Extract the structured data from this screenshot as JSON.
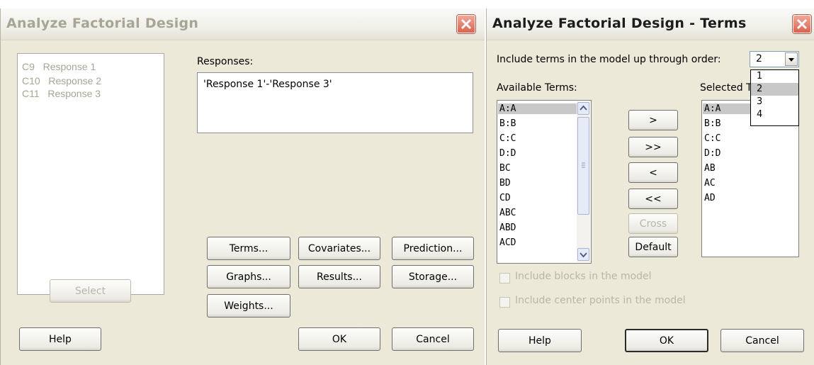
{
  "dialog1": {
    "title": "Analyze Factorial Design",
    "columns": [
      {
        "id": "C9",
        "name": "Response 1"
      },
      {
        "id": "C10",
        "name": "Response 2"
      },
      {
        "id": "C11",
        "name": "Response 3"
      }
    ],
    "select_label": "Select",
    "responses_label": "Responses:",
    "responses_value": "'Response 1'-'Response 3'",
    "buttons": {
      "terms": "Terms...",
      "covariates": "Covariates...",
      "prediction": "Prediction...",
      "graphs": "Graphs...",
      "results": "Results...",
      "storage": "Storage...",
      "weights": "Weights...",
      "help": "Help",
      "ok": "OK",
      "cancel": "Cancel"
    }
  },
  "dialog2": {
    "title": "Analyze Factorial Design - Terms",
    "order_label": "Include terms in the model up through order:",
    "order_value": "2",
    "order_options": [
      "1",
      "2",
      "3",
      "4"
    ],
    "available_label": "Available Terms:",
    "selected_label": "Selected T",
    "available_terms": [
      "A:A",
      "B:B",
      "C:C",
      "D:D",
      "BC",
      "BD",
      "CD",
      "ABC",
      "ABD",
      "ACD"
    ],
    "selected_terms": [
      "A:A",
      "B:B",
      "C:C",
      "D:D",
      "AB",
      "AC",
      "AD"
    ],
    "buttons": {
      "add": ">",
      "add_all": ">>",
      "remove": "<",
      "remove_all": "<<",
      "cross": "Cross",
      "default": "Default",
      "help": "Help",
      "ok": "OK",
      "cancel": "Cancel"
    },
    "include_blocks": "Include blocks in the model",
    "include_center": "Include center points in the model"
  }
}
